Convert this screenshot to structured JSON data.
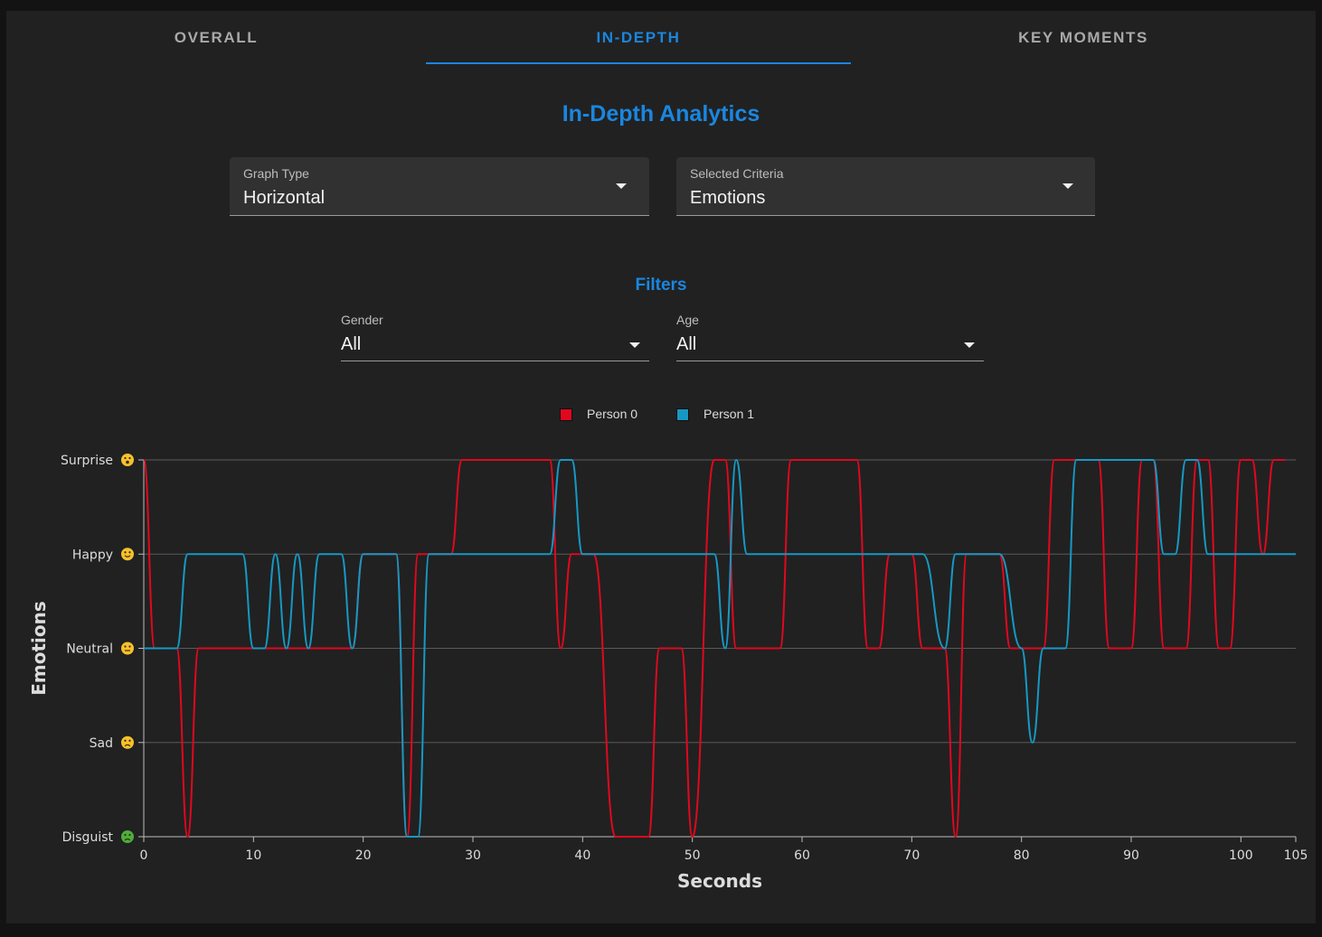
{
  "tabs": [
    {
      "label": "OVERALL",
      "active": false
    },
    {
      "label": "IN-DEPTH",
      "active": true
    },
    {
      "label": "KEY MOMENTS",
      "active": false
    }
  ],
  "page_title": "In-Depth Analytics",
  "graph_type": {
    "label": "Graph Type",
    "value": "Horizontal"
  },
  "selected_criteria": {
    "label": "Selected Criteria",
    "value": "Emotions"
  },
  "filters_title": "Filters",
  "gender": {
    "label": "Gender",
    "value": "All"
  },
  "age": {
    "label": "Age",
    "value": "All"
  },
  "colors": {
    "accent": "#1a86e0",
    "person0": "#e0081f",
    "person1": "#1698c3"
  },
  "chart_data": {
    "type": "line",
    "xlabel": "Seconds",
    "ylabel": "Emotions",
    "xlim": [
      0,
      105
    ],
    "x_ticks": [
      0,
      10,
      20,
      30,
      40,
      50,
      60,
      70,
      80,
      90,
      100,
      105
    ],
    "y_categories": [
      "Disguist",
      "Sad",
      "Neutral",
      "Happy",
      "Surprise"
    ],
    "y_icons": [
      "disgust-emoji-icon",
      "sad-emoji-icon",
      "neutral-emoji-icon",
      "happy-emoji-icon",
      "surprise-emoji-icon"
    ],
    "legend_position": "top-center",
    "grid": "horizontal",
    "series": [
      {
        "name": "Person 0",
        "color": "#e0081f",
        "points": [
          [
            0,
            4
          ],
          [
            1,
            2
          ],
          [
            3,
            2
          ],
          [
            4,
            0
          ],
          [
            5,
            2
          ],
          [
            19,
            2
          ],
          [
            20,
            3
          ],
          [
            23,
            3
          ],
          [
            24,
            0
          ],
          [
            25,
            3
          ],
          [
            28,
            3
          ],
          [
            29,
            4
          ],
          [
            37,
            4
          ],
          [
            38,
            2
          ],
          [
            39,
            3
          ],
          [
            41,
            3
          ],
          [
            43,
            0
          ],
          [
            46,
            0
          ],
          [
            47,
            2
          ],
          [
            49,
            2
          ],
          [
            50,
            0
          ],
          [
            52,
            4
          ],
          [
            53,
            4
          ],
          [
            54,
            2
          ],
          [
            58,
            2
          ],
          [
            59,
            4
          ],
          [
            65,
            4
          ],
          [
            66,
            2
          ],
          [
            67,
            2
          ],
          [
            68,
            3
          ],
          [
            70,
            3
          ],
          [
            71,
            2
          ],
          [
            73,
            2
          ],
          [
            74,
            0
          ],
          [
            75,
            3
          ],
          [
            78,
            3
          ],
          [
            79,
            2
          ],
          [
            82,
            2
          ],
          [
            83,
            4
          ],
          [
            87,
            4
          ],
          [
            88,
            2
          ],
          [
            90,
            2
          ],
          [
            91,
            4
          ],
          [
            92,
            4
          ],
          [
            93,
            2
          ],
          [
            95,
            2
          ],
          [
            96,
            4
          ],
          [
            97,
            4
          ],
          [
            98,
            2
          ],
          [
            99,
            2
          ],
          [
            100,
            4
          ],
          [
            101,
            4
          ],
          [
            102,
            3
          ],
          [
            103,
            4
          ],
          [
            104,
            4
          ]
        ]
      },
      {
        "name": "Person 1",
        "color": "#1698c3",
        "points": [
          [
            0,
            2
          ],
          [
            3,
            2
          ],
          [
            4,
            3
          ],
          [
            9,
            3
          ],
          [
            10,
            2
          ],
          [
            11,
            2
          ],
          [
            12,
            3
          ],
          [
            13,
            2
          ],
          [
            14,
            3
          ],
          [
            15,
            2
          ],
          [
            16,
            3
          ],
          [
            18,
            3
          ],
          [
            19,
            2
          ],
          [
            20,
            3
          ],
          [
            23,
            3
          ],
          [
            24,
            0
          ],
          [
            25,
            0
          ],
          [
            26,
            3
          ],
          [
            37,
            3
          ],
          [
            38,
            4
          ],
          [
            39,
            4
          ],
          [
            40,
            3
          ],
          [
            52,
            3
          ],
          [
            53,
            2
          ],
          [
            54,
            4
          ],
          [
            55,
            3
          ],
          [
            68,
            3
          ],
          [
            71,
            3
          ],
          [
            73,
            2
          ],
          [
            74,
            3
          ],
          [
            78,
            3
          ],
          [
            80,
            2
          ],
          [
            81,
            1
          ],
          [
            82,
            2
          ],
          [
            84,
            2
          ],
          [
            85,
            4
          ],
          [
            92,
            4
          ],
          [
            93,
            3
          ],
          [
            94,
            3
          ],
          [
            95,
            4
          ],
          [
            96,
            4
          ],
          [
            97,
            3
          ],
          [
            105,
            3
          ]
        ]
      }
    ]
  }
}
